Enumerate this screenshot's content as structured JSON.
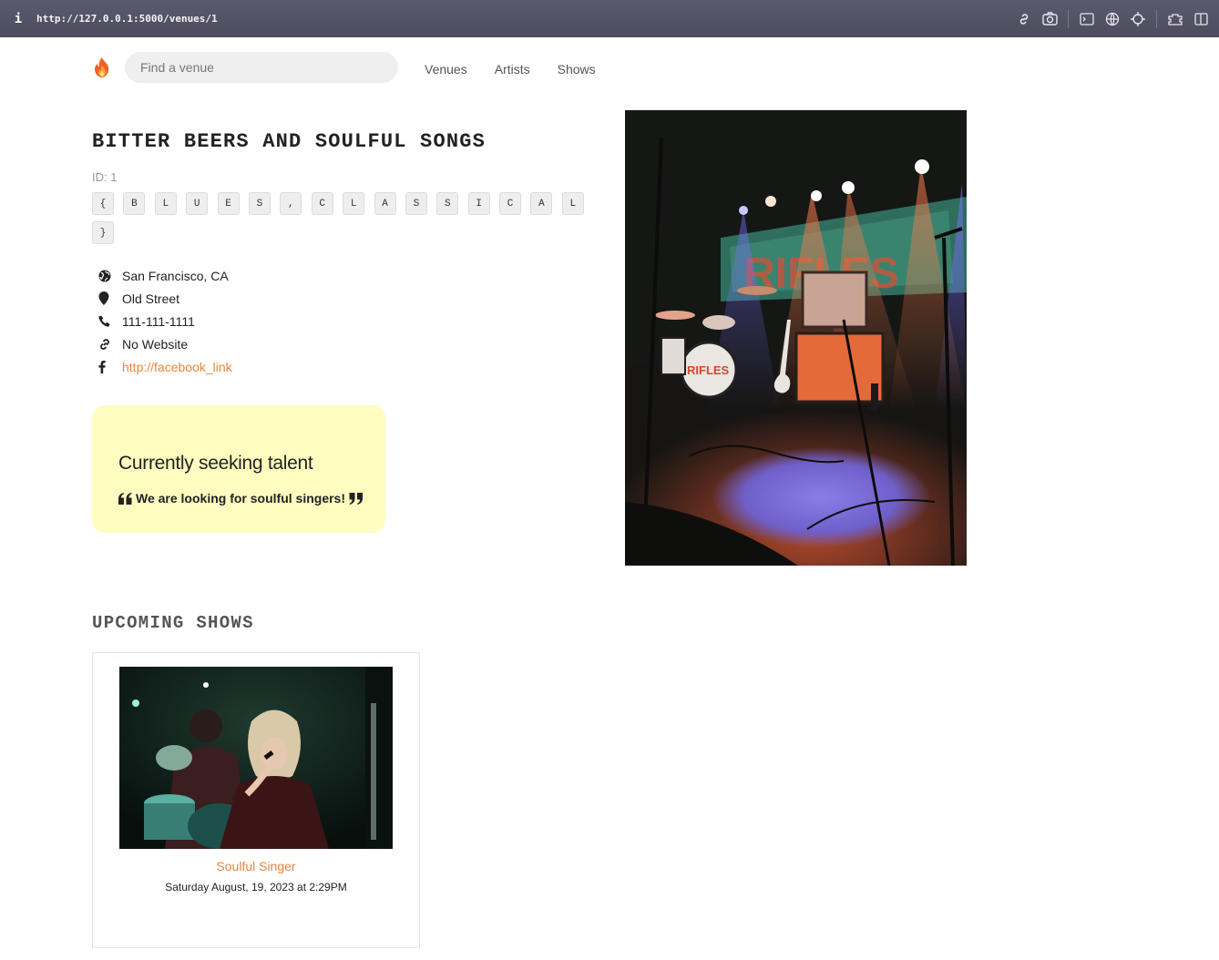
{
  "browser": {
    "url": "http://127.0.0.1:5000/venues/1",
    "info_glyph": "i",
    "toolbar_icons": [
      "link-icon",
      "camera-icon",
      "terminal-icon",
      "globe-icon",
      "crosshair-icon",
      "extension-icon",
      "sidebar-icon"
    ]
  },
  "nav": {
    "logo_icon": "flame-icon",
    "search_placeholder": "Find a venue",
    "links": [
      "Venues",
      "Artists",
      "Shows"
    ]
  },
  "venue": {
    "name": "BITTER BEERS AND SOULFUL SONGS",
    "id_text": "ID: 1",
    "genre_chars": [
      "{",
      "B",
      "L",
      "U",
      "E",
      "S",
      ",",
      "C",
      "L",
      "A",
      "S",
      "S",
      "I",
      "C",
      "A",
      "L",
      "}"
    ],
    "city_state": "San Francisco, CA",
    "address": "Old Street",
    "phone": "111-111-1111",
    "website": "No Website",
    "facebook": "http://facebook_link",
    "seeking_title": "Currently seeking talent",
    "seeking_description": "We are looking for soulful singers!",
    "image_alt": "Venue Image"
  },
  "upcoming": {
    "heading": "UPCOMING SHOWS",
    "shows": [
      {
        "artist": "Soulful Singer",
        "date": "Saturday August, 19, 2023 at 2:29PM",
        "image_alt": "Show Artist Image"
      }
    ]
  },
  "colors": {
    "accent": "#e8853b",
    "seeking_bg": "#fffcc0",
    "chrome_bg": "#55536a"
  }
}
